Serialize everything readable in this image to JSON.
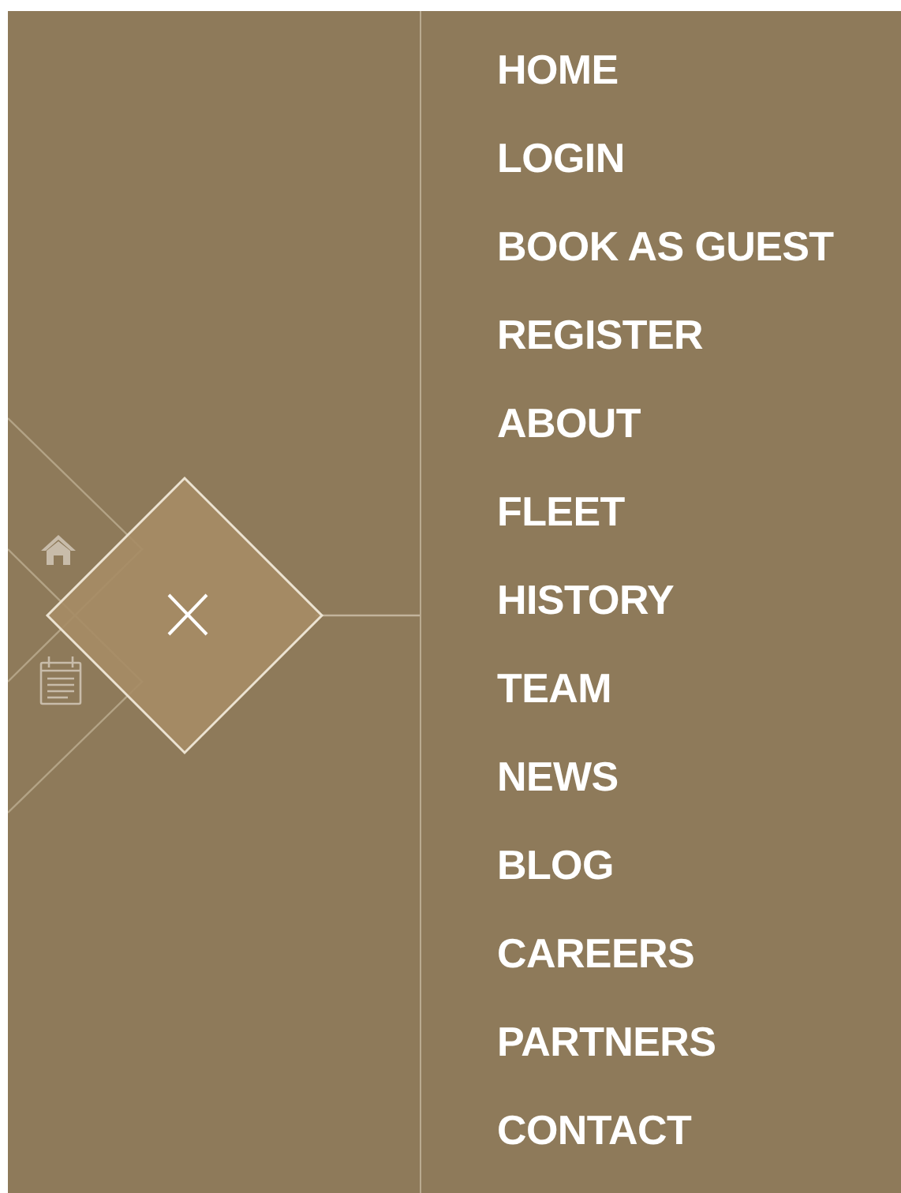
{
  "menu": {
    "items": [
      {
        "label": "HOME"
      },
      {
        "label": "LOGIN"
      },
      {
        "label": "BOOK AS GUEST"
      },
      {
        "label": "REGISTER"
      },
      {
        "label": "ABOUT"
      },
      {
        "label": "FLEET"
      },
      {
        "label": "HISTORY"
      },
      {
        "label": "TEAM"
      },
      {
        "label": "NEWS"
      },
      {
        "label": "BLOG"
      },
      {
        "label": "CAREERS"
      },
      {
        "label": "PARTNERS"
      },
      {
        "label": "CONTACT"
      }
    ]
  }
}
